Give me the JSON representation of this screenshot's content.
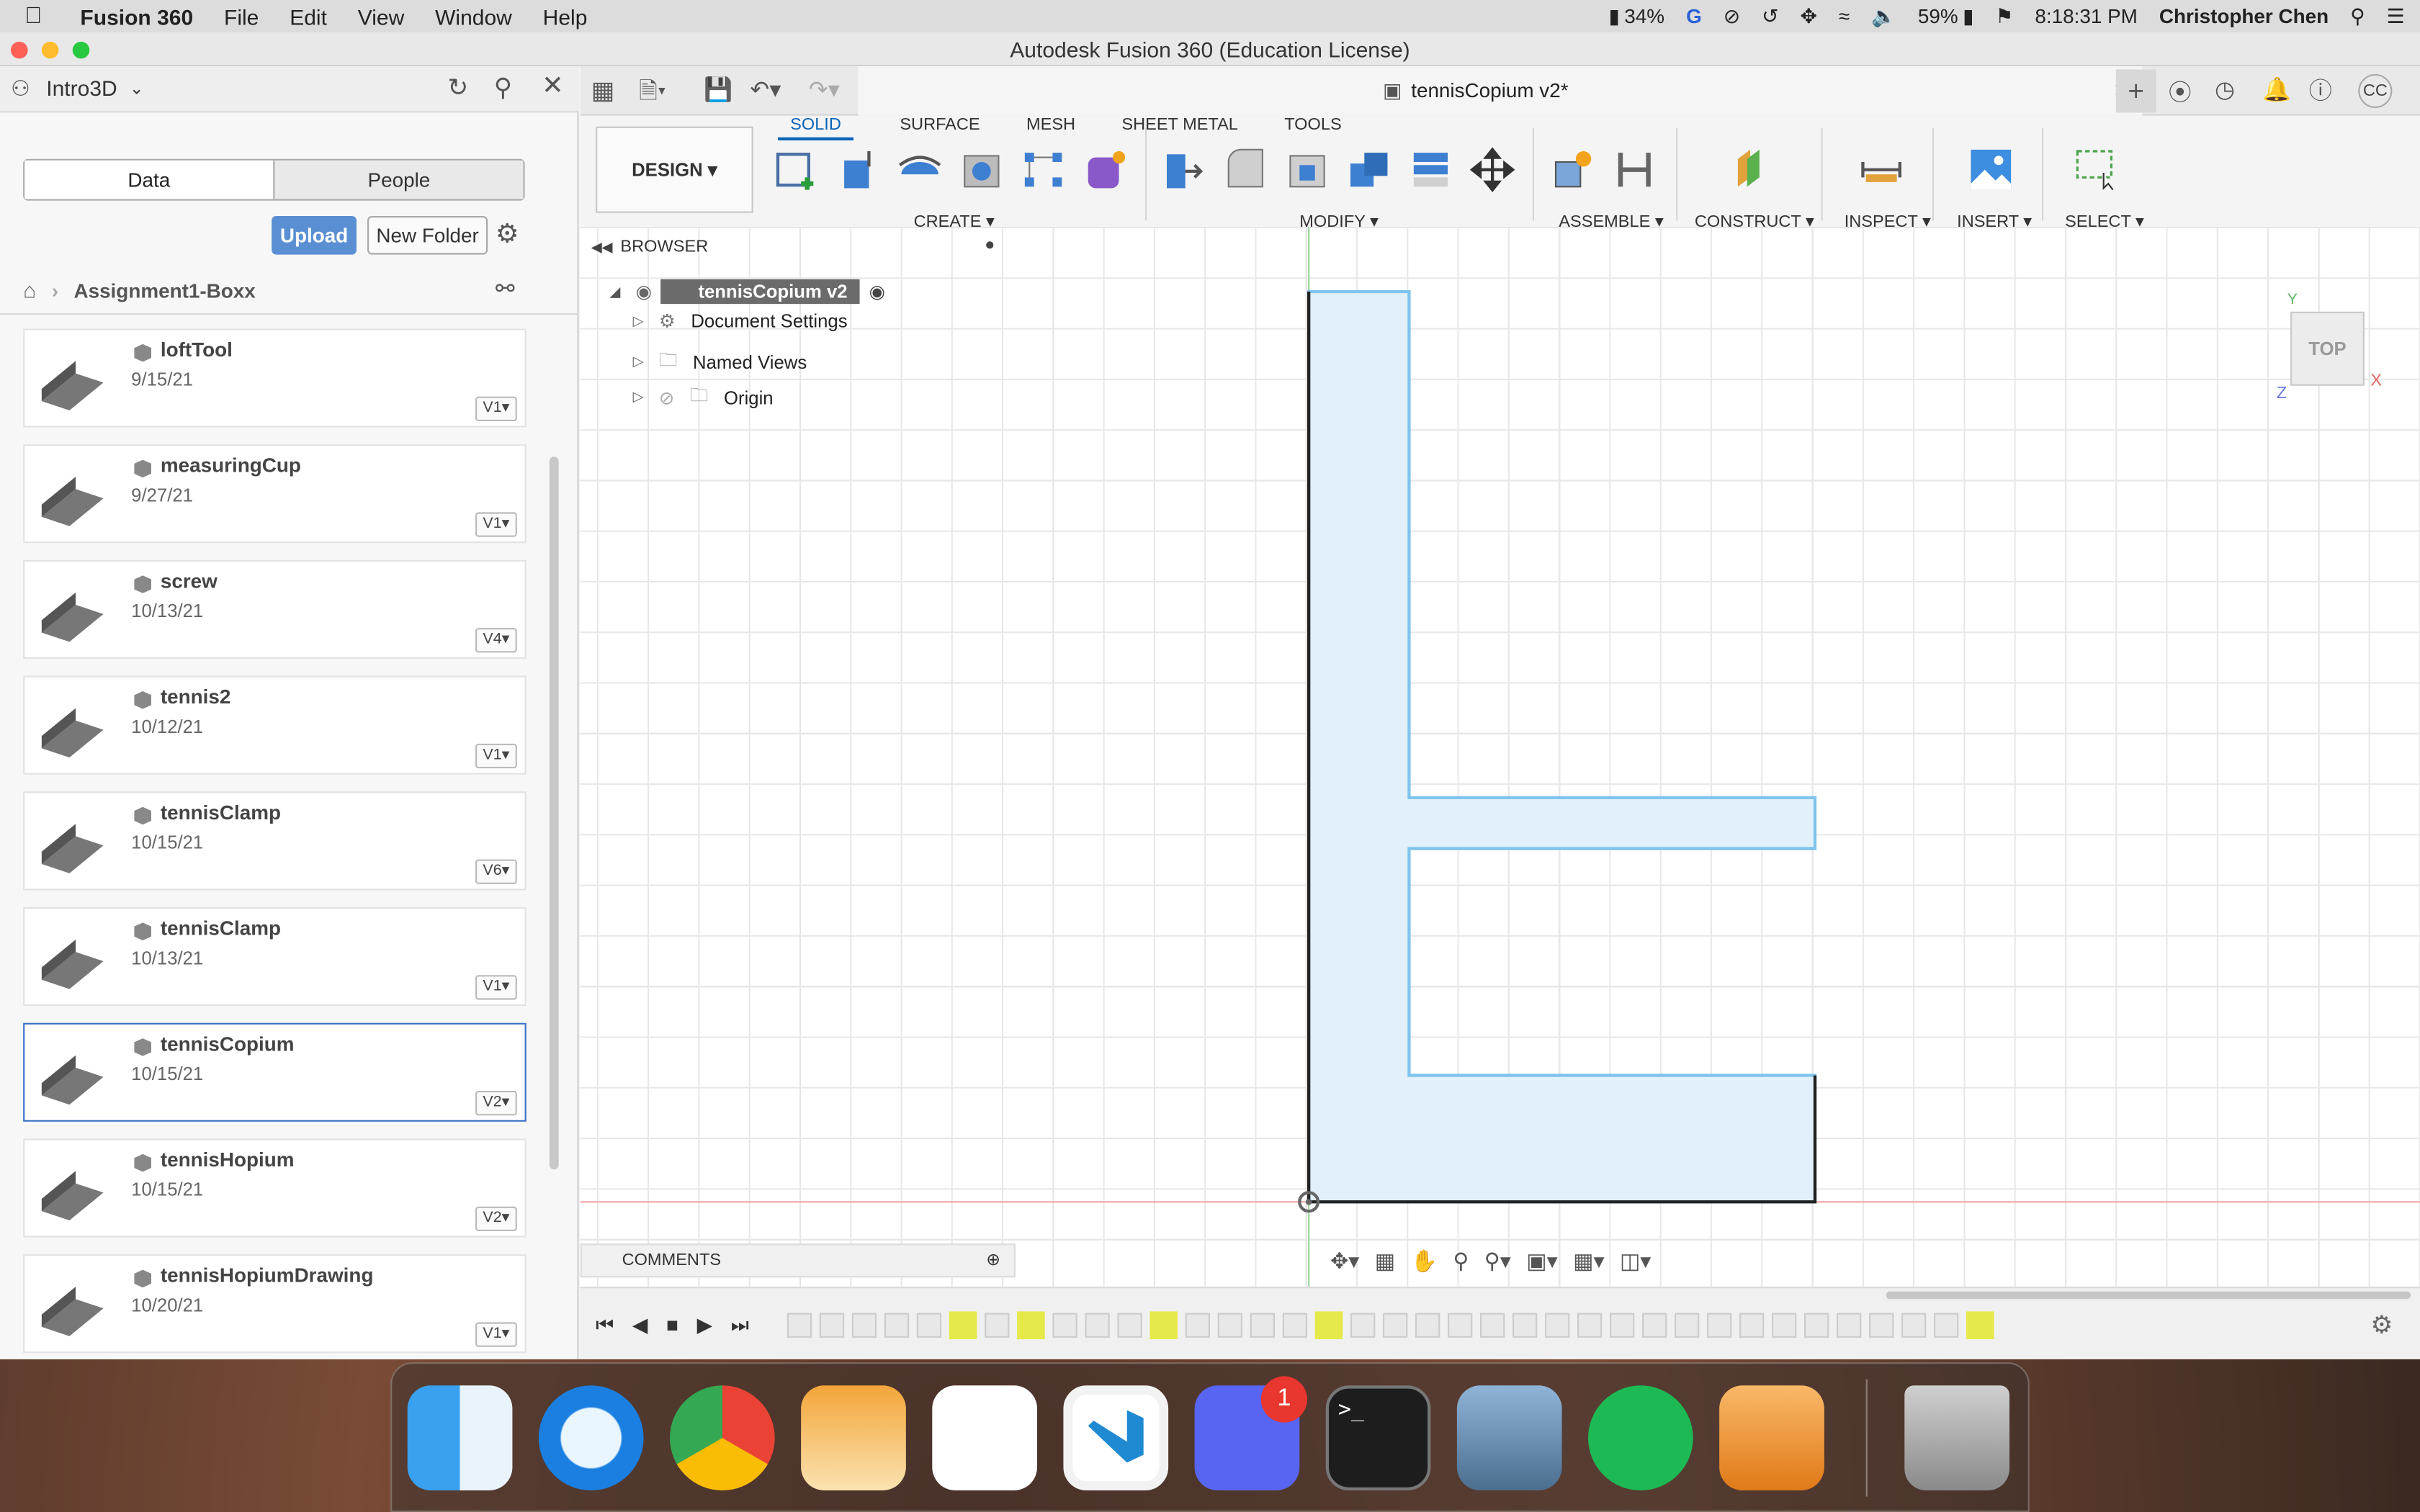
{
  "menubar": {
    "app_name": "Fusion 360",
    "items": [
      "File",
      "Edit",
      "View",
      "Window",
      "Help"
    ],
    "battery_pct_1": "34%",
    "battery_pct_2": "59%",
    "time": "8:18:31 PM",
    "user": "Christopher Chen"
  },
  "window": {
    "title": "Autodesk Fusion 360 (Education License)"
  },
  "datapanel": {
    "project": "Intro3D",
    "tab_data": "Data",
    "tab_people": "People",
    "upload_label": "Upload",
    "new_folder_label": "New Folder",
    "breadcrumb": "Assignment1-Boxx",
    "files": [
      {
        "name": "loftTool",
        "date": "9/15/21",
        "version": "V1"
      },
      {
        "name": "measuringCup",
        "date": "9/27/21",
        "version": "V1"
      },
      {
        "name": "screw",
        "date": "10/13/21",
        "version": "V4"
      },
      {
        "name": "tennis2",
        "date": "10/12/21",
        "version": "V1"
      },
      {
        "name": "tennisClamp",
        "date": "10/15/21",
        "version": "V6"
      },
      {
        "name": "tennisClamp",
        "date": "10/13/21",
        "version": "V1"
      },
      {
        "name": "tennisCopium",
        "date": "10/15/21",
        "version": "V2"
      },
      {
        "name": "tennisHopium",
        "date": "10/15/21",
        "version": "V2"
      },
      {
        "name": "tennisHopiumDrawing",
        "date": "10/20/21",
        "version": "V1"
      }
    ]
  },
  "document": {
    "tab_title": "tennisCopium v2*",
    "workspace": "DESIGN",
    "tabs": [
      "SOLID",
      "SURFACE",
      "MESH",
      "SHEET METAL",
      "TOOLS"
    ],
    "groups": [
      "CREATE",
      "MODIFY",
      "ASSEMBLE",
      "CONSTRUCT",
      "INSPECT",
      "INSERT",
      "SELECT"
    ],
    "browser_label": "BROWSER",
    "root_node": "tennisCopium v2",
    "nodes": [
      "Document Settings",
      "Named Views",
      "Origin"
    ],
    "comments_label": "COMMENTS",
    "viewcube_label": "TOP",
    "axis_y": "Y",
    "axis_x": "X",
    "axis_z": "Z",
    "user_initials": "CC"
  },
  "dock": {
    "discord_badge": "1"
  },
  "colors": {
    "accent": "#0a64b8",
    "upload_button": "#5b8fd3",
    "sketch_fill": "#e1f0fa",
    "sketch_line": "#7ec4ec"
  }
}
